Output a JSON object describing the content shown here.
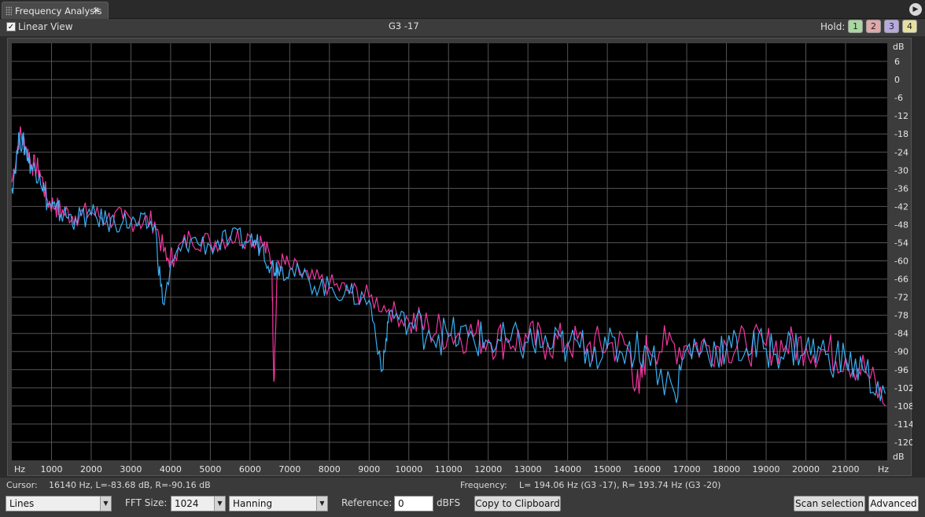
{
  "tab": {
    "title": "Frequency Analysis",
    "close": "×",
    "menu": "▶"
  },
  "top": {
    "linear_view_label": "Linear View",
    "linear_view_checked": true,
    "note": "G3 -17",
    "hold_label": "Hold:",
    "hold_buttons": [
      {
        "label": "1",
        "color": "#a8d8a0"
      },
      {
        "label": "2",
        "color": "#e0a8a8"
      },
      {
        "label": "3",
        "color": "#b8a8e0"
      },
      {
        "label": "4",
        "color": "#e8e0a0"
      }
    ]
  },
  "chart_data": {
    "type": "line",
    "xlabel": "Hz",
    "ylabel": "dB",
    "x_ticks": [
      1000,
      2000,
      3000,
      4000,
      5000,
      6000,
      7000,
      8000,
      9000,
      10000,
      11000,
      12000,
      13000,
      14000,
      15000,
      16000,
      17000,
      18000,
      19000,
      20000,
      21000
    ],
    "y_ticks": [
      6,
      0,
      -6,
      -12,
      -18,
      -24,
      -30,
      -36,
      -42,
      -48,
      -54,
      -60,
      -66,
      -72,
      -78,
      -84,
      -90,
      -96,
      -102,
      -108,
      -114,
      -120
    ],
    "xlim": [
      0,
      22050
    ],
    "ylim": [
      -126,
      12
    ],
    "grid": true,
    "series": [
      {
        "color": "#ff3aa8",
        "points": [
          [
            0,
            -34
          ],
          [
            200,
            -18
          ],
          [
            350,
            -22
          ],
          [
            500,
            -28
          ],
          [
            700,
            -30
          ],
          [
            900,
            -40
          ],
          [
            1100,
            -42
          ],
          [
            1300,
            -44
          ],
          [
            1600,
            -45
          ],
          [
            2000,
            -44
          ],
          [
            2400,
            -46
          ],
          [
            2800,
            -46
          ],
          [
            3200,
            -47
          ],
          [
            3600,
            -47
          ],
          [
            3900,
            -60
          ],
          [
            4100,
            -58
          ],
          [
            4500,
            -52
          ],
          [
            5000,
            -54
          ],
          [
            5500,
            -52
          ],
          [
            6000,
            -52
          ],
          [
            6300,
            -54
          ],
          [
            6550,
            -60
          ],
          [
            6600,
            -100
          ],
          [
            6700,
            -60
          ],
          [
            7000,
            -62
          ],
          [
            7500,
            -66
          ],
          [
            8000,
            -68
          ],
          [
            8500,
            -70
          ],
          [
            9000,
            -72
          ],
          [
            9500,
            -76
          ],
          [
            10000,
            -80
          ],
          [
            10500,
            -82
          ],
          [
            11000,
            -84
          ],
          [
            11500,
            -84
          ],
          [
            12000,
            -86
          ],
          [
            12500,
            -86
          ],
          [
            13000,
            -86
          ],
          [
            13500,
            -87
          ],
          [
            14000,
            -87
          ],
          [
            14500,
            -88
          ],
          [
            15000,
            -88
          ],
          [
            15500,
            -88
          ],
          [
            15800,
            -104
          ],
          [
            16000,
            -88
          ],
          [
            16500,
            -88
          ],
          [
            17000,
            -88
          ],
          [
            17500,
            -88
          ],
          [
            18000,
            -88
          ],
          [
            18500,
            -88
          ],
          [
            19000,
            -88
          ],
          [
            19500,
            -88
          ],
          [
            20000,
            -88
          ],
          [
            20500,
            -90
          ],
          [
            21000,
            -92
          ],
          [
            21500,
            -96
          ],
          [
            22000,
            -108
          ]
        ]
      },
      {
        "color": "#3ab8ff",
        "points": [
          [
            0,
            -36
          ],
          [
            200,
            -19
          ],
          [
            350,
            -23
          ],
          [
            500,
            -29
          ],
          [
            700,
            -31
          ],
          [
            900,
            -41
          ],
          [
            1100,
            -43
          ],
          [
            1300,
            -45
          ],
          [
            1600,
            -46
          ],
          [
            2000,
            -45
          ],
          [
            2400,
            -47
          ],
          [
            2800,
            -47
          ],
          [
            3200,
            -48
          ],
          [
            3600,
            -48
          ],
          [
            3800,
            -74
          ],
          [
            4100,
            -59
          ],
          [
            4500,
            -53
          ],
          [
            5000,
            -55
          ],
          [
            5500,
            -53
          ],
          [
            6000,
            -53
          ],
          [
            6300,
            -55
          ],
          [
            6550,
            -62
          ],
          [
            6700,
            -62
          ],
          [
            7000,
            -63
          ],
          [
            7500,
            -67
          ],
          [
            8000,
            -69
          ],
          [
            8500,
            -71
          ],
          [
            9000,
            -73
          ],
          [
            9350,
            -96
          ],
          [
            9500,
            -77
          ],
          [
            10000,
            -81
          ],
          [
            10500,
            -83
          ],
          [
            11000,
            -85
          ],
          [
            11500,
            -85
          ],
          [
            12000,
            -87
          ],
          [
            12500,
            -87
          ],
          [
            13000,
            -87
          ],
          [
            13500,
            -88
          ],
          [
            14000,
            -88
          ],
          [
            14500,
            -89
          ],
          [
            15000,
            -89
          ],
          [
            15500,
            -89
          ],
          [
            16000,
            -89
          ],
          [
            16700,
            -104
          ],
          [
            17000,
            -89
          ],
          [
            17500,
            -89
          ],
          [
            18000,
            -89
          ],
          [
            18500,
            -89
          ],
          [
            19000,
            -89
          ],
          [
            19500,
            -89
          ],
          [
            20000,
            -89
          ],
          [
            20500,
            -91
          ],
          [
            21000,
            -93
          ],
          [
            21500,
            -97
          ],
          [
            22000,
            -104
          ]
        ]
      }
    ]
  },
  "status": {
    "cursor_label": "Cursor:",
    "cursor_value": "16140 Hz, L=-83.68 dB, R=-90.16 dB",
    "frequency_label": "Frequency:",
    "frequency_value": "L= 194.06 Hz (G3 -17), R= 193.74 Hz (G3 -20)"
  },
  "controls": {
    "display_mode": "Lines",
    "fft_label": "FFT Size:",
    "fft_size": "1024",
    "window": "Hanning",
    "reference_label": "Reference:",
    "reference_value": "0",
    "reference_unit": "dBFS",
    "copy_button": "Copy to Clipboard",
    "scan_button": "Scan selection",
    "advanced_button": "Advanced"
  }
}
